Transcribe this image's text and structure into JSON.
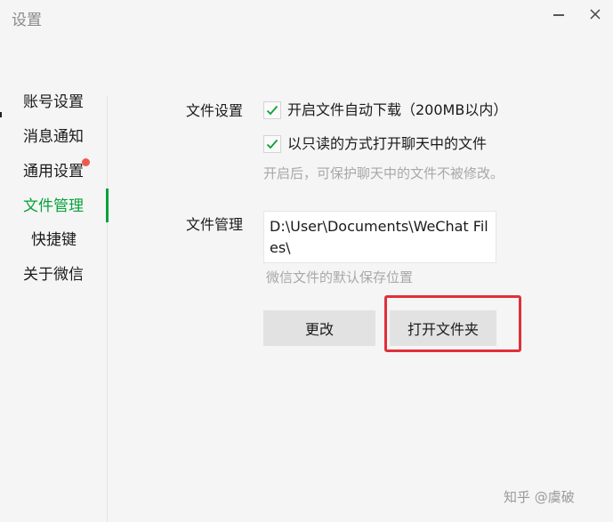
{
  "window": {
    "title": "设置"
  },
  "sidebar": {
    "items": [
      {
        "label": "账号设置"
      },
      {
        "label": "消息通知"
      },
      {
        "label": "通用设置"
      },
      {
        "label": "文件管理"
      },
      {
        "label": "快捷键"
      },
      {
        "label": "关于微信"
      }
    ]
  },
  "file_settings": {
    "label": "文件设置",
    "auto_download_label": "开启文件自动下载（200MB以内）",
    "auto_download_checked": true,
    "readonly_label": "以只读的方式打开聊天中的文件",
    "readonly_checked": true,
    "readonly_hint": "开启后，可保护聊天中的文件不被修改。"
  },
  "file_management": {
    "label": "文件管理",
    "path": "D:\\User\\Documents\\WeChat Files\\",
    "path_hint": "微信文件的默认保存位置",
    "change_button": "更改",
    "open_folder_button": "打开文件夹"
  },
  "watermark": "知乎 @虞破",
  "colors": {
    "accent": "#07a23a",
    "notification_dot": "#f05a4d",
    "highlight": "#e0303a"
  },
  "icons": {
    "checkbox": "check-icon",
    "minimize": "minimize-icon",
    "close": "close-icon"
  }
}
